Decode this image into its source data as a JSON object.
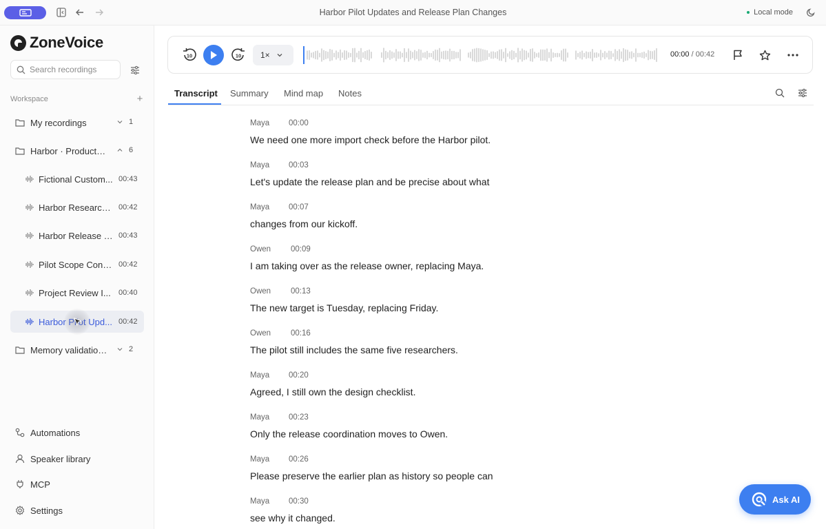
{
  "window": {
    "title": "Harbor Pilot Updates and Release Plan Changes",
    "mode": "Local mode"
  },
  "app": {
    "name": "ZoneVoice"
  },
  "sidebar": {
    "search_placeholder": "Search recordings",
    "workspace_label": "Workspace",
    "add_label": "+",
    "folders": [
      {
        "label": "My recordings",
        "count": "1"
      },
      {
        "label": "Harbor · Product c...",
        "count": "6"
      },
      {
        "label": "Memory validation ...",
        "count": "2"
      }
    ],
    "recordings": [
      {
        "label": "Fictional Custom...",
        "time": "00:43"
      },
      {
        "label": "Harbor Research ...",
        "time": "00:42"
      },
      {
        "label": "Harbor Release P...",
        "time": "00:43"
      },
      {
        "label": "Pilot Scope Confi...",
        "time": "00:42"
      },
      {
        "label": "Project Review I...",
        "time": "00:40"
      },
      {
        "label": "Harbor Pilot Upd...",
        "time": "00:42"
      }
    ],
    "bottom": [
      {
        "label": "Automations"
      },
      {
        "label": "Speaker library"
      },
      {
        "label": "MCP"
      },
      {
        "label": "Settings"
      }
    ]
  },
  "player": {
    "speed": "1×",
    "current_time": "00:00",
    "separator": " / ",
    "total_time": "00:42"
  },
  "tabs": [
    {
      "label": "Transcript"
    },
    {
      "label": "Summary"
    },
    {
      "label": "Mind map"
    },
    {
      "label": "Notes"
    }
  ],
  "transcript": [
    {
      "speaker": "Maya",
      "time": "00:00",
      "text": "We need one more import check before the Harbor pilot."
    },
    {
      "speaker": "Maya",
      "time": "00:03",
      "text": "Let's update the release plan and be precise about what"
    },
    {
      "speaker": "Maya",
      "time": "00:07",
      "text": "changes from our kickoff."
    },
    {
      "speaker": "Owen",
      "time": "00:09",
      "text": "I am taking over as the release owner, replacing Maya."
    },
    {
      "speaker": "Owen",
      "time": "00:13",
      "text": "The new target is Tuesday, replacing Friday."
    },
    {
      "speaker": "Owen",
      "time": "00:16",
      "text": "The pilot still includes the same five researchers."
    },
    {
      "speaker": "Maya",
      "time": "00:20",
      "text": "Agreed, I still own the design checklist."
    },
    {
      "speaker": "Maya",
      "time": "00:23",
      "text": "Only the release coordination moves to Owen."
    },
    {
      "speaker": "Maya",
      "time": "00:26",
      "text": "Please preserve the earlier plan as history so people can"
    },
    {
      "speaker": "Maya",
      "time": "00:30",
      "text": "see why it changed."
    }
  ],
  "ask_ai": {
    "label": "Ask AI"
  },
  "colors": {
    "accent": "#3d7ff0",
    "brand_pill": "#5b5fe6",
    "active_item_text": "#3b5bdb"
  }
}
